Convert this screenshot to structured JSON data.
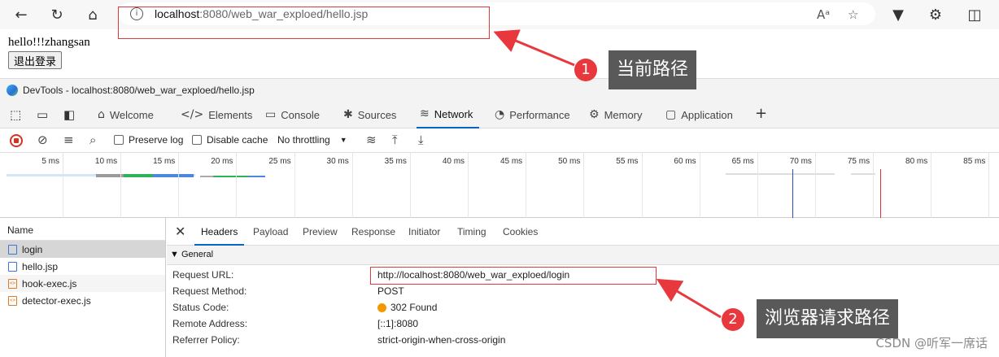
{
  "browser": {
    "url_host": "localhost",
    "url_rest": ":8080/web_war_exploed/hello.jsp",
    "icons": [
      "back-icon",
      "reload-icon",
      "home-icon",
      "read-aloud-icon",
      "favorite-icon",
      "shield-icon",
      "extensions-icon",
      "split-screen-icon"
    ]
  },
  "page": {
    "greeting": "hello!!!zhangsan",
    "logout_label": "退出登录"
  },
  "annotations": {
    "a1_num": "1",
    "a1_label": "当前路径",
    "a2_num": "2",
    "a2_label": "浏览器请求路径",
    "accent": "#e8383d"
  },
  "devtools": {
    "title": "DevTools - localhost:8080/web_war_exploed/hello.jsp",
    "tabs": [
      {
        "label": "Welcome"
      },
      {
        "label": "Elements"
      },
      {
        "label": "Console"
      },
      {
        "label": "Sources"
      },
      {
        "label": "Network"
      },
      {
        "label": "Performance"
      },
      {
        "label": "Memory"
      },
      {
        "label": "Application"
      }
    ],
    "network_bar": {
      "preserve_log": "Preserve log",
      "disable_cache": "Disable cache",
      "throttling": "No throttling"
    },
    "timeline_ticks": [
      "5 ms",
      "10 ms",
      "15 ms",
      "20 ms",
      "25 ms",
      "30 ms",
      "35 ms",
      "40 ms",
      "45 ms",
      "50 ms",
      "55 ms",
      "60 ms",
      "65 ms",
      "70 ms",
      "75 ms",
      "80 ms",
      "85 ms"
    ],
    "name_header": "Name",
    "requests": [
      {
        "name": "login",
        "type": "doc"
      },
      {
        "name": "hello.jsp",
        "type": "doc"
      },
      {
        "name": "hook-exec.js",
        "type": "js"
      },
      {
        "name": "detector-exec.js",
        "type": "js"
      }
    ],
    "detail_tabs": [
      "Headers",
      "Payload",
      "Preview",
      "Response",
      "Initiator",
      "Timing",
      "Cookies"
    ],
    "section_title": "▼ General",
    "general": [
      {
        "key": "Request URL:",
        "value": "http://localhost:8080/web_war_exploed/login"
      },
      {
        "key": "Request Method:",
        "value": "POST"
      },
      {
        "key": "Status Code:",
        "value": "302 Found"
      },
      {
        "key": "Remote Address:",
        "value": "[::1]:8080"
      },
      {
        "key": "Referrer Policy:",
        "value": "strict-origin-when-cross-origin"
      }
    ]
  },
  "watermark": "CSDN @听军一席话"
}
